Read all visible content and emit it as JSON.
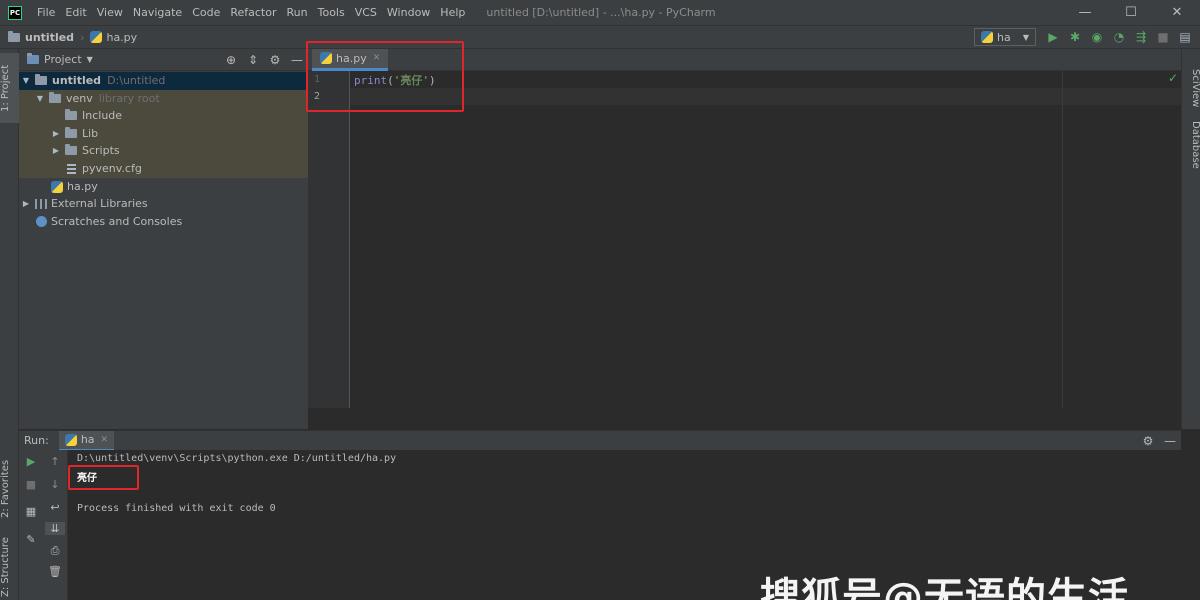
{
  "menubar": {
    "app_icon": "PC",
    "items": [
      "File",
      "Edit",
      "View",
      "Navigate",
      "Code",
      "Refactor",
      "Run",
      "Tools",
      "VCS",
      "Window",
      "Help"
    ],
    "window_title": "untitled [D:\\untitled] - ...\\ha.py - PyCharm",
    "controls": {
      "minimize": "—",
      "maximize": "☐",
      "close": "✕"
    }
  },
  "navbar": {
    "project": "untitled",
    "file": "ha.py",
    "run_config": "ha"
  },
  "left_strip": {
    "project_tab": "1: Project",
    "favorites_tab": "2: Favorites",
    "structure_tab": "Z: Structure"
  },
  "right_strip": {
    "sciview_tab": "SciView",
    "database_tab": "Database"
  },
  "project_panel": {
    "title": "Project",
    "tree": [
      {
        "label": "untitled",
        "hint": "D:\\untitled"
      },
      {
        "label": "venv",
        "hint": "library root"
      },
      {
        "label": "Include"
      },
      {
        "label": "Lib"
      },
      {
        "label": "Scripts"
      },
      {
        "label": "pyvenv.cfg"
      },
      {
        "label": "ha.py"
      },
      {
        "label": "External Libraries"
      },
      {
        "label": "Scratches and Consoles"
      }
    ]
  },
  "editor": {
    "tab_label": "ha.py",
    "line_numbers": [
      "1",
      "2"
    ],
    "code": {
      "fn": "print",
      "open": "(",
      "string": "'亮仔'",
      "close": ")"
    }
  },
  "run_panel": {
    "label": "Run:",
    "tab": "ha",
    "console": {
      "command": "D:\\untitled\\venv\\Scripts\\python.exe D:/untitled/ha.py",
      "output": "亮仔",
      "exit": "Process finished with exit code 0"
    }
  },
  "watermark": "搜狐号@无语的生活",
  "colors": {
    "highlight": "#e0262b",
    "accent": "#4a88c7",
    "run_green": "#59a869"
  }
}
